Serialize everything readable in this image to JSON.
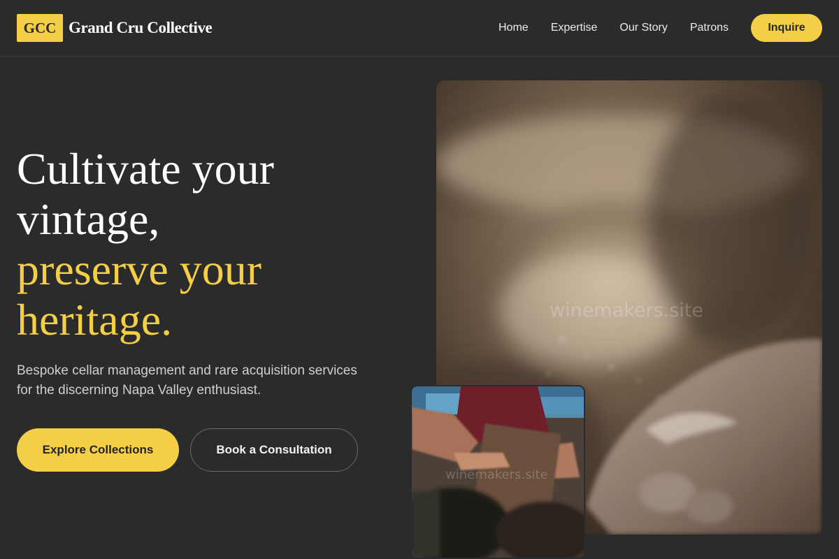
{
  "brand": {
    "logo_text": "GCC",
    "name": "Grand Cru Collective"
  },
  "nav": {
    "items": [
      "Home",
      "Expertise",
      "Our Story",
      "Patrons"
    ],
    "cta": "Inquire"
  },
  "hero": {
    "headline_line1": "Cultivate your",
    "headline_line2": "vintage,",
    "headline_line3": "preserve your",
    "headline_line4": "heritage.",
    "subtext": "Bespoke cellar management and rare acquisition services for the discerning Napa Valley enthusiast.",
    "primary_button": "Explore Collections",
    "secondary_button": "Book a Consultation"
  },
  "images": {
    "main_watermark": "winemakers.site",
    "small_watermark": "winemakers.site"
  },
  "colors": {
    "background": "#2b2b2b",
    "accent": "#f4cf45",
    "text": "#ffffff"
  }
}
